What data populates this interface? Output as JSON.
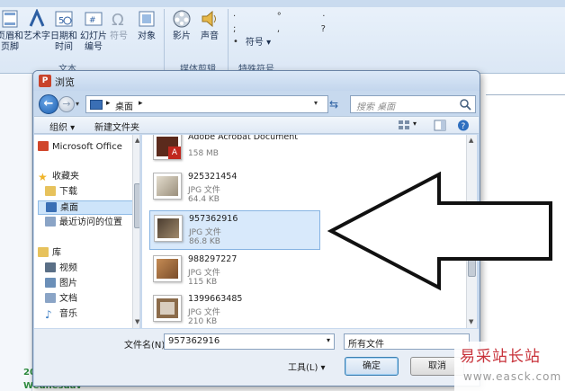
{
  "ribbon": {
    "buttons": [
      {
        "label": "页眉和\n页脚",
        "icon": "header-footer-icon"
      },
      {
        "label": "艺术字",
        "icon": "wordart-icon"
      },
      {
        "label": "日期和\n时间",
        "icon": "date-time-icon"
      },
      {
        "label": "幻灯片\n编号",
        "icon": "slide-number-icon"
      },
      {
        "label": "符号",
        "icon": "omega-icon"
      },
      {
        "label": "对象",
        "icon": "object-icon"
      },
      {
        "label": "影片",
        "icon": "film-reel-icon"
      },
      {
        "label": "声音",
        "icon": "speaker-icon"
      },
      {
        "label": "符号",
        "icon": "symbol-dropdown-icon"
      }
    ],
    "groups": [
      "文本",
      "媒体剪辑",
      "特殊符号"
    ],
    "symbol_chars": "·   °   ·\n;   ,   ?\n•"
  },
  "background_doc": {
    "green_text_1": "20",
    "green_text_2": "Wednesdav"
  },
  "dialog": {
    "title": "浏览",
    "address": "桌面",
    "search_placeholder": "搜索 桌面",
    "toolbar": {
      "organize": "组织 ▾",
      "new_folder": "新建文件夹"
    },
    "nav_items": [
      {
        "label": "Microsoft Office",
        "icon": "office-icon",
        "color": "#d0462b"
      },
      {
        "label": "收藏夹",
        "icon": "star-icon",
        "color": "#f0b429"
      },
      {
        "label": "下载",
        "icon": "download-folder-icon",
        "color": "#e7c25c"
      },
      {
        "label": "桌面",
        "icon": "desktop-icon",
        "color": "#3a6fb5"
      },
      {
        "label": "最近访问的位置",
        "icon": "recent-places-icon",
        "color": "#8aa4c6"
      },
      {
        "label": "库",
        "icon": "library-icon",
        "color": "#e7c25c"
      },
      {
        "label": "视频",
        "icon": "video-icon",
        "color": "#5a6f86"
      },
      {
        "label": "图片",
        "icon": "pictures-icon",
        "color": "#6b8fb8"
      },
      {
        "label": "文档",
        "icon": "documents-icon",
        "color": "#8aa4c6"
      },
      {
        "label": "音乐",
        "icon": "music-icon",
        "color": "#3d7fc4"
      }
    ],
    "files": [
      {
        "name": "Adobe Acrobat Document",
        "type": "",
        "size": "158 MB",
        "thumb": "pdf"
      },
      {
        "name": "925321454",
        "type": "JPG 文件",
        "size": "64.4 KB",
        "thumb": "photo-light"
      },
      {
        "name": "957362916",
        "type": "JPG 文件",
        "size": "86.8 KB",
        "thumb": "photo-dark",
        "selected": true
      },
      {
        "name": "988297227",
        "type": "JPG 文件",
        "size": "115 KB",
        "thumb": "photo-brown"
      },
      {
        "name": "1399663485",
        "type": "JPG 文件",
        "size": "210 KB",
        "thumb": "photo-frame"
      }
    ],
    "filename_label": "文件名(N):",
    "filename_value": "957362916",
    "filetype_value": "所有文件",
    "tools_label": "工具(L)  ▾",
    "ok_label": "确定",
    "cancel_label": "取消"
  },
  "watermark": {
    "cn": "易采站长站",
    "url": "www.easck.com"
  }
}
